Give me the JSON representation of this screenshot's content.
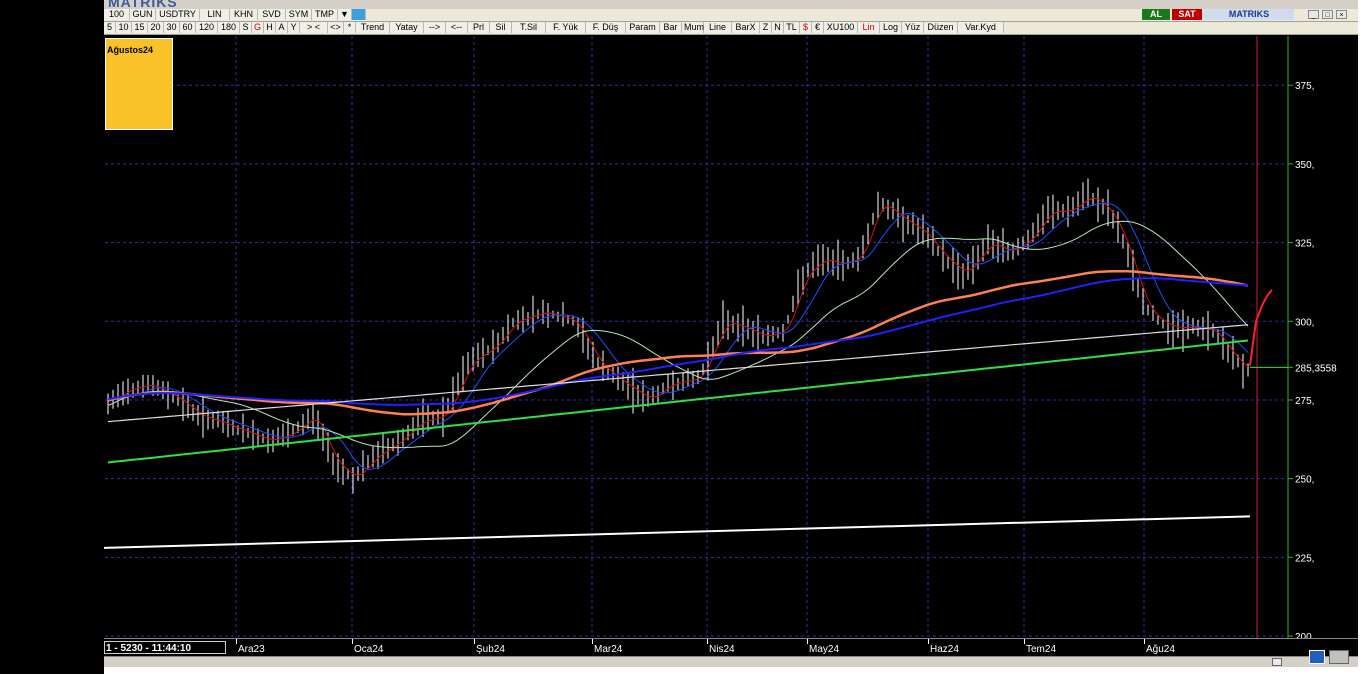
{
  "app": {
    "logo": "MATRIKS"
  },
  "toolbar1": {
    "items": [
      "100",
      "GUN",
      "USDTRY",
      "LIN",
      "KHN",
      "SVD",
      "SYM",
      "TMP"
    ],
    "al_label": "AL",
    "sat_label": "SAT",
    "brand": "MATRIKS"
  },
  "toolbar2": {
    "items": [
      {
        "t": "5"
      },
      {
        "t": "10"
      },
      {
        "t": "15"
      },
      {
        "t": "20"
      },
      {
        "t": "30"
      },
      {
        "t": "60"
      },
      {
        "t": "120"
      },
      {
        "t": "180"
      },
      {
        "t": "S"
      },
      {
        "t": "G",
        "red": true
      },
      {
        "t": "H"
      },
      {
        "t": "A"
      },
      {
        "t": "Y"
      },
      {
        "t": ">  <"
      },
      {
        "t": "<>"
      },
      {
        "t": "*"
      },
      {
        "t": "Trend"
      },
      {
        "t": "Yatay"
      },
      {
        "t": "-->"
      },
      {
        "t": "<--"
      },
      {
        "t": "Prl"
      },
      {
        "t": "Sil"
      },
      {
        "t": "T.Sil"
      },
      {
        "t": "F. Yük"
      },
      {
        "t": "F. Düş"
      },
      {
        "t": "Param"
      },
      {
        "t": "Bar"
      },
      {
        "t": "Mum"
      },
      {
        "t": "Line"
      },
      {
        "t": "BarX"
      },
      {
        "t": "Z"
      },
      {
        "t": "N"
      },
      {
        "t": "TL"
      },
      {
        "t": "$",
        "red": true
      },
      {
        "t": "€"
      },
      {
        "t": "XU100"
      },
      {
        "t": "Lin",
        "red": true
      },
      {
        "t": "Log"
      },
      {
        "t": "Yüz"
      },
      {
        "t": "Düzen"
      },
      {
        "t": "Var.Kyd"
      }
    ]
  },
  "legend": {
    "label": "Ağustos24"
  },
  "status": {
    "text": "1 - 5230 - 11:44:10"
  },
  "chart_data": {
    "type": "bar",
    "title": "",
    "symbol": "USDTRY",
    "xlabel": "",
    "ylabel": "",
    "y_ticks": [
      "375,",
      "350,",
      "325,",
      "300,",
      "285,3558",
      "275,",
      "250,",
      "225,",
      "200,"
    ],
    "y_values": [
      375,
      350,
      325,
      300,
      275,
      250,
      225,
      200
    ],
    "ylim": [
      200,
      390
    ],
    "last_price": 285.3558,
    "last_price_label": "285,3558",
    "x_labels": [
      "Ara23",
      "Oca24",
      "Şub24",
      "Mar24",
      "Nis24",
      "May24",
      "Haz24",
      "Tem24",
      "Ağu24"
    ],
    "grid": true,
    "colors": {
      "bars": "#ffffff",
      "ma_red": "#d01010",
      "ma_blue": "#1e4cff",
      "ma_lightgreen": "#b8e6b8",
      "ma_orange": "#ff8050",
      "ma_darkblue": "#2020ff",
      "ma_white": "#dddddd",
      "ma_green": "#30e040",
      "trend_white": "#ffffff",
      "projection": "#ff2020",
      "grid": "#3030a0",
      "axis": "#2bb32b"
    }
  }
}
